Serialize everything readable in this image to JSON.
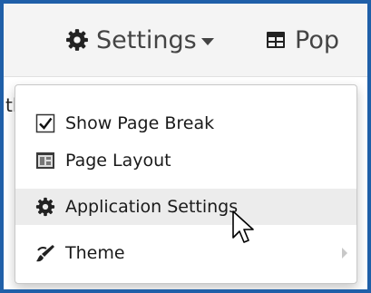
{
  "toolbar": {
    "settings_label": "Settings",
    "next_label_partial": "Pop"
  },
  "background_text": "tl",
  "menu": {
    "items": [
      {
        "label": "Show Page Break",
        "icon": "checkbox-checked-icon",
        "checked": true
      },
      {
        "label": "Page Layout",
        "icon": "page-layout-icon"
      },
      {
        "label": "Application Settings",
        "icon": "gear-icon",
        "hovered": true
      },
      {
        "label": "Theme",
        "icon": "paint-brush-icon",
        "has_submenu": true
      }
    ]
  },
  "colors": {
    "frame_border": "#1f5fa8",
    "toolbar_background": "#f4f4f4",
    "hover_background": "#ececec"
  }
}
